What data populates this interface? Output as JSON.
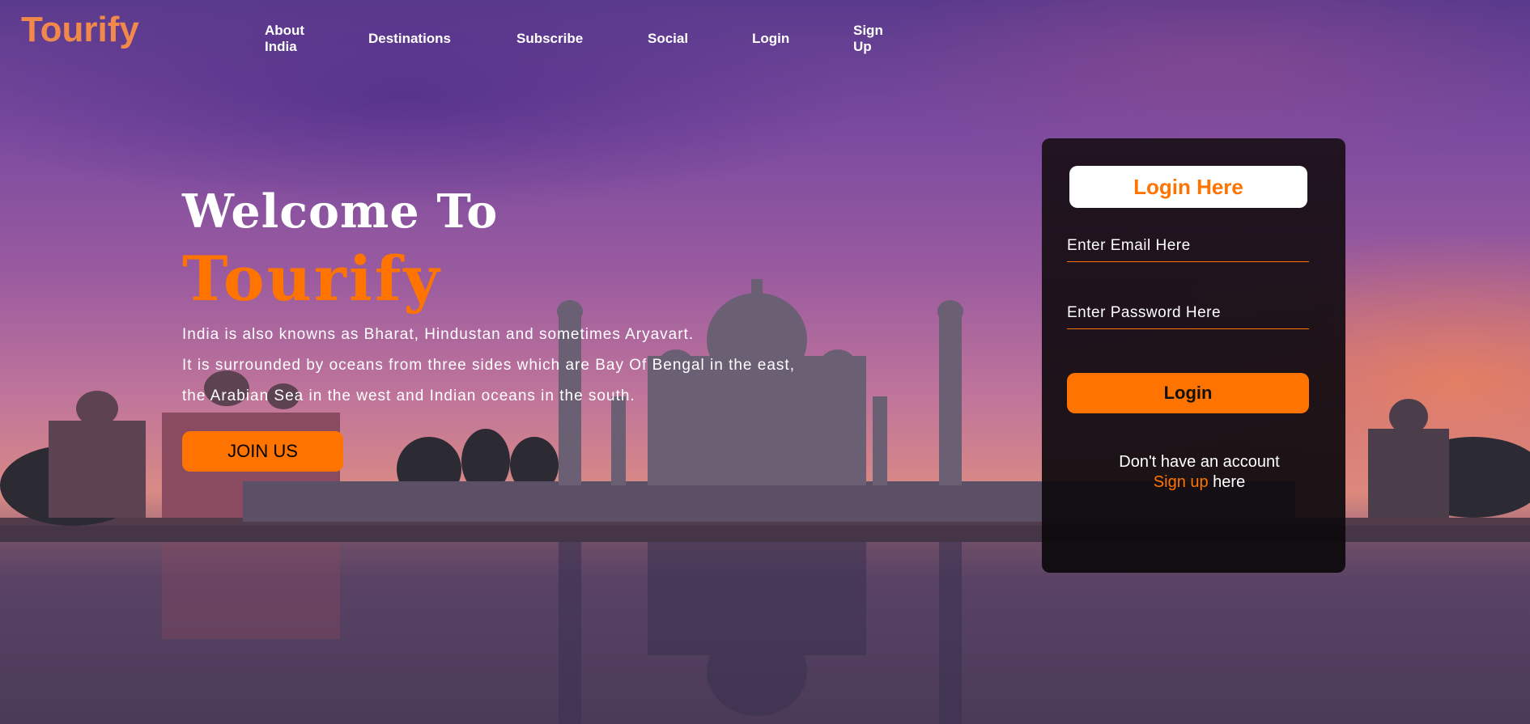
{
  "brand": {
    "logo": "Tourify"
  },
  "nav": [
    {
      "label": "About\nIndia"
    },
    {
      "label": "Destinations"
    },
    {
      "label": "Subscribe"
    },
    {
      "label": "Social"
    },
    {
      "label": "Login"
    },
    {
      "label": "Sign\nUp"
    }
  ],
  "hero": {
    "welcome": "Welcome To",
    "brand": "Tourify",
    "description": [
      "India is also knowns as Bharat, Hindustan and sometimes Aryavart.",
      "It is surrounded by oceans from three sides which are Bay Of Bengal in the east,",
      "the Arabian Sea in the west and Indian oceans in the south."
    ],
    "join_label": "JOIN US"
  },
  "login": {
    "title": "Login Here",
    "email_placeholder": "Enter Email Here",
    "password_placeholder": "Enter Password Here",
    "button_label": "Login",
    "no_account_text": "Don't have an account",
    "signup_link": "Sign up",
    "signup_suffix": " here"
  },
  "colors": {
    "accent": "#ff7300",
    "logo": "#f0894b"
  }
}
